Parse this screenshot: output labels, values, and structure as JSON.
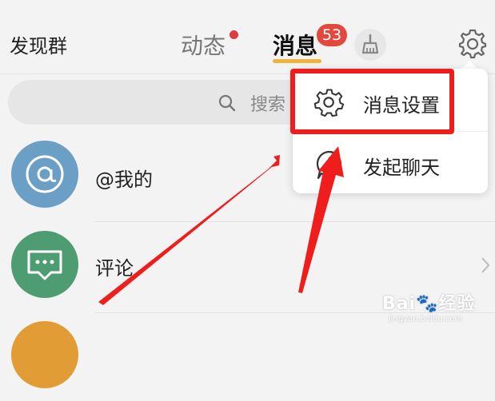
{
  "header": {
    "left_label": "发现群",
    "tabs": [
      {
        "label": "动态"
      },
      {
        "label": "消息"
      }
    ],
    "badge_count": "53"
  },
  "search": {
    "placeholder": "搜索"
  },
  "list": [
    {
      "label": "@我的"
    },
    {
      "label": "评论"
    },
    {
      "label": ""
    }
  ],
  "popup_menu": {
    "items": [
      {
        "label": "消息设置",
        "icon": "gear-icon"
      },
      {
        "label": "发起聊天",
        "icon": "chat-bubble-icon"
      }
    ]
  },
  "watermark": {
    "brand": "Bai",
    "brand2": "经验",
    "url": "jingyan.baidu.com"
  },
  "colors": {
    "accent_underline": "#f0b43c",
    "badge": "#e2483d",
    "annotation": "#f01d1d"
  }
}
